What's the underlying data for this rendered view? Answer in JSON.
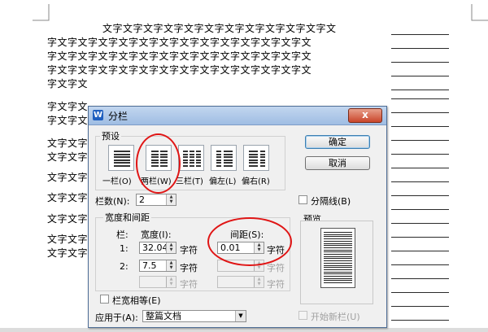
{
  "document": {
    "lines": [
      "文字文字文字文字文字文字文字文字文字文字文字文",
      "字文字文字文字文字文字文字文字文字文字文字文字文字文",
      "字文字文字文字文字文字文字文字文字文字文字文字文字文",
      "字文字文字文字文字文字文字文字文字文字文字文字文字文",
      "字文字文",
      "字文字文",
      "字文字文",
      "文字文字",
      "文字文字",
      "文字文字",
      "文字文字",
      "文字文字",
      "文字文字",
      "文字文字"
    ]
  },
  "dialog": {
    "title": "分栏",
    "app_icon": "W",
    "close_glyph": "x",
    "presets": {
      "label": "预设",
      "items": [
        {
          "label": "一栏(O)",
          "icon": "one-column-icon"
        },
        {
          "label": "两栏(W)",
          "icon": "two-column-icon"
        },
        {
          "label": "三栏(T)",
          "icon": "three-column-icon"
        },
        {
          "label": "偏左(L)",
          "icon": "left-column-icon"
        },
        {
          "label": "偏右(R)",
          "icon": "right-column-icon"
        }
      ]
    },
    "ok_label": "确定",
    "cancel_label": "取消",
    "column_count_label": "栏数(N):",
    "column_count_value": "2",
    "separator_label": "分隔线(B)",
    "width_spacing": {
      "group_label": "宽度和间距",
      "col_header": "栏:",
      "width_header": "宽度(I):",
      "spacing_header": "间距(S):",
      "unit": "字符",
      "rows": [
        {
          "col": "1:",
          "width": "32.04",
          "spacing": "0.01"
        },
        {
          "col": "2:",
          "width": "7.5",
          "spacing": ""
        },
        {
          "col": "",
          "width": "",
          "spacing": ""
        }
      ]
    },
    "equal_width_label": "栏宽相等(E)",
    "preview_label": "预览",
    "apply_to_label": "应用于(A):",
    "apply_to_value": "整篇文档",
    "new_column_label": "开始新栏(U)"
  },
  "colors": {
    "highlight": "#e01515",
    "titlebar": "#9fbde3"
  }
}
